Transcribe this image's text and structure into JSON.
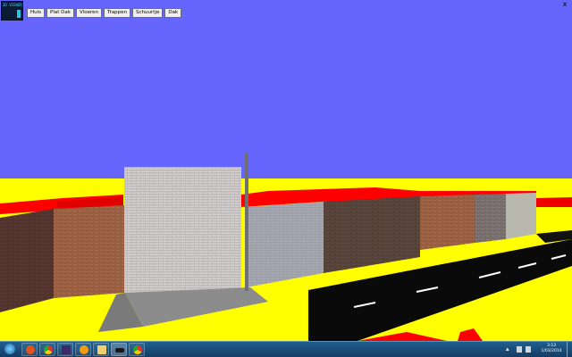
{
  "app": {
    "panel_label": "3D VIEWER",
    "close_glyph": "x"
  },
  "toolbar": {
    "buttons": [
      "Huis",
      "Plat Dak",
      "Vloeren",
      "Trappen",
      "Schuurtje",
      "Dak"
    ]
  },
  "scene": {
    "sky_color": "#6666ff",
    "ground_color": "#ffff00",
    "roof_color": "#ff0000",
    "road_color": "#0a0a0a",
    "road_marking_color": "#ffffff",
    "pavement_color": "#8c8c8c",
    "pole_color": "#707070"
  },
  "taskbar": {
    "icons": [
      "start-orb-icon",
      "settings-icon",
      "chrome-icon",
      "premiere-icon",
      "media-player-icon",
      "folder-icon",
      "car-window-icon",
      "chrome-icon-2"
    ],
    "clock_time": "3:13",
    "clock_date": "1/03/2014"
  }
}
